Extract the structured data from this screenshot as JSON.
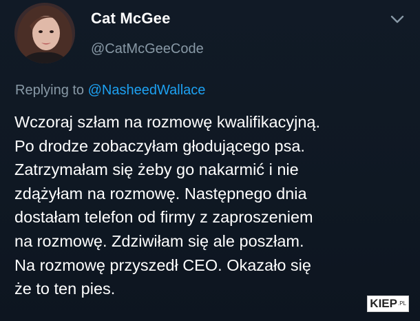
{
  "tweet": {
    "author": {
      "display_name": "Cat McGee",
      "handle": "@CatMcGeeCode",
      "avatar_icon": "profile-photo"
    },
    "reply": {
      "prefix": "Replying to ",
      "mention": "@NasheedWallace"
    },
    "body_lines": [
      "Wczoraj szłam na rozmowę kwalifikacyjną.",
      "Po drodze zobaczyłam głodującego psa.",
      "Zatrzymałam się żeby go nakarmić i nie",
      "zdążyłam na rozmowę. Następnego dnia",
      "dostałam telefon od firmy z zaproszeniem",
      "na rozmowę. Zdziwiłam się ale poszłam.",
      "Na rozmowę przyszedł CEO. Okazało się",
      "że to ten pies."
    ],
    "menu_icon": "chevron-down-icon"
  },
  "watermark": {
    "text": "KIEP",
    "suffix": ".PL"
  },
  "colors": {
    "background": "#0e1621",
    "text_primary": "#ffffff",
    "text_secondary": "#8899a6",
    "link": "#1da1f2"
  }
}
